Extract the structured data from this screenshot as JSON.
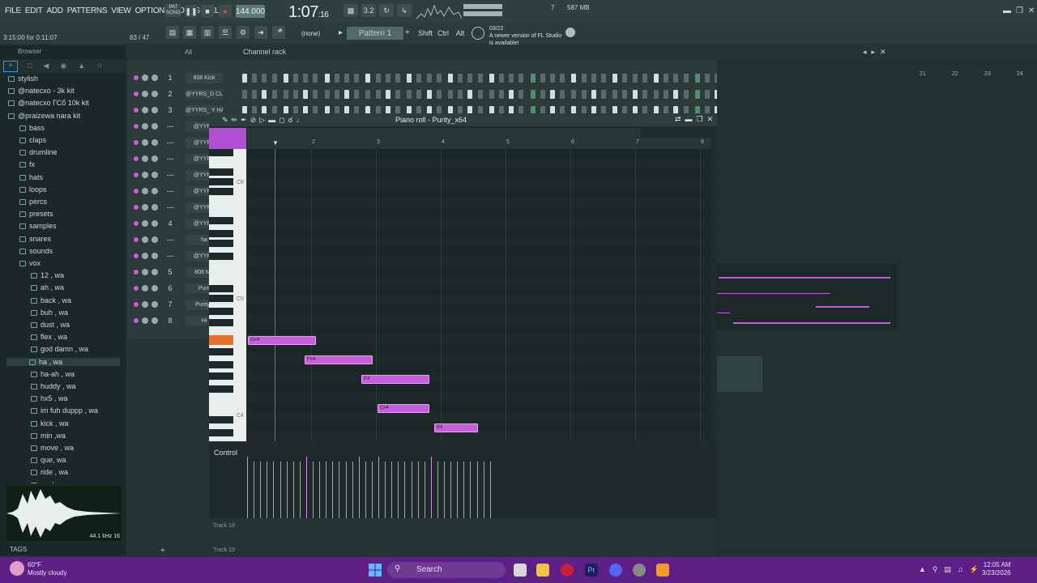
{
  "menu": [
    "FILE",
    "EDIT",
    "ADD",
    "PATTERNS",
    "VIEW",
    "OPTIONS",
    "TOOLS",
    "HELP"
  ],
  "transport": {
    "mode_label": "PAT SONG",
    "tempo": "144.000",
    "time": "1:07",
    "time_small": ":16",
    "cpu": "587 MB",
    "polyphony": "7"
  },
  "hint": "3:15:00 for 0:11:07",
  "hint_right": "83 / 47",
  "toolbar": {
    "snap": "(none)",
    "pattern": "Pattern 1",
    "shift": "Shift",
    "ctrl": "Ctrl",
    "alt": "Alt",
    "news_date": "03/22",
    "news_text": "A newer version of FL Studio is available!"
  },
  "browser": {
    "title": "Browser",
    "filter": "All",
    "items": [
      {
        "label": "stylish",
        "depth": 0
      },
      {
        "label": "@natecxo - 3k kit",
        "depth": 0
      },
      {
        "label": "@natecxo ГСб 10k kit",
        "depth": 0
      },
      {
        "label": "@praizewa nara kit",
        "depth": 0
      },
      {
        "label": "bass",
        "depth": 1
      },
      {
        "label": "claps",
        "depth": 1
      },
      {
        "label": "drumline",
        "depth": 1
      },
      {
        "label": "fx",
        "depth": 1
      },
      {
        "label": "hats",
        "depth": 1
      },
      {
        "label": "loops",
        "depth": 1
      },
      {
        "label": "percs",
        "depth": 1
      },
      {
        "label": "presets",
        "depth": 1
      },
      {
        "label": "samples",
        "depth": 1
      },
      {
        "label": "snares",
        "depth": 1
      },
      {
        "label": "sounds",
        "depth": 1
      },
      {
        "label": "vox",
        "depth": 1
      },
      {
        "label": "12 , wa",
        "depth": 2
      },
      {
        "label": "ah , wa",
        "depth": 2
      },
      {
        "label": "back , wa",
        "depth": 2
      },
      {
        "label": "buh , wa",
        "depth": 2
      },
      {
        "label": "dust , wa",
        "depth": 2
      },
      {
        "label": "flex , wa",
        "depth": 2
      },
      {
        "label": "god damn , wa",
        "depth": 2
      },
      {
        "label": "ha , wa",
        "depth": 3
      },
      {
        "label": "ha-ah , wa",
        "depth": 2
      },
      {
        "label": "huddy , wa",
        "depth": 2
      },
      {
        "label": "hx5 , wa",
        "depth": 2
      },
      {
        "label": "im fuh duppp , wa",
        "depth": 2
      },
      {
        "label": "kick , wa",
        "depth": 2
      },
      {
        "label": "min ,wa",
        "depth": 2
      },
      {
        "label": "move , wa",
        "depth": 2
      },
      {
        "label": "que, wa",
        "depth": 2
      },
      {
        "label": "ride , wa",
        "depth": 2
      },
      {
        "label": "yeah , wa",
        "depth": 2
      },
      {
        "label": "yup , wa",
        "depth": 2
      }
    ],
    "sample_info": "44.1 kHz 16",
    "tags": "TAGS"
  },
  "channel_rack": {
    "title": "Channel rack",
    "filter": "All",
    "channels": [
      {
        "num": "1",
        "name": "808 Kick"
      },
      {
        "num": "2",
        "name": "@YYRS_D CLAP"
      },
      {
        "num": "3",
        "name": "@YYRS_ Y HAT"
      },
      {
        "num": "---",
        "name": "@YYRS"
      },
      {
        "num": "---",
        "name": "@YYRS"
      },
      {
        "num": "---",
        "name": "@YYRS"
      },
      {
        "num": "---",
        "name": "@YYRS"
      },
      {
        "num": "---",
        "name": "@YYRS"
      },
      {
        "num": "---",
        "name": "@YYRS"
      },
      {
        "num": "4",
        "name": "@YYRS"
      },
      {
        "num": "---",
        "name": "ha"
      },
      {
        "num": "---",
        "name": "@YYRS"
      },
      {
        "num": "5",
        "name": "808 Mo"
      },
      {
        "num": "6",
        "name": "Purit"
      },
      {
        "num": "7",
        "name": "Purity_"
      },
      {
        "num": "8",
        "name": "Hi"
      }
    ]
  },
  "piano_roll": {
    "title": "Piano roll - Purity_x64",
    "ruler": [
      "2",
      "3",
      "4",
      "5",
      "6",
      "7",
      "8"
    ],
    "key_labels": [
      "C6",
      "C5",
      "C4"
    ],
    "notes": [
      {
        "label": "G#4"
      },
      {
        "label": "F#4"
      },
      {
        "label": "E4"
      },
      {
        "label": "C#4"
      },
      {
        "label": "B3"
      }
    ],
    "control_label": "Control"
  },
  "playlist": {
    "ruler": [
      "21",
      "22",
      "23",
      "24"
    ]
  },
  "tracks": [
    "Track 18",
    "Track 19"
  ],
  "weather": {
    "temp": "60°F",
    "desc": "Mostly cloudy"
  },
  "taskbar": {
    "search": "Search",
    "time": "12:05 AM",
    "date": "3/23/2026"
  }
}
